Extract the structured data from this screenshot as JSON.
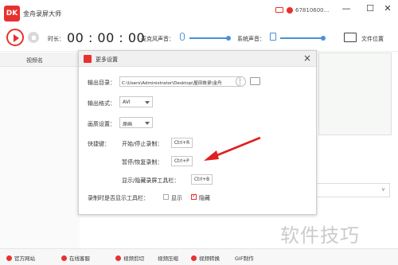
{
  "app": {
    "logo_text": "DK",
    "title": "金舟录屏大师",
    "user_id": "67810600..."
  },
  "window": {
    "minimize": "—",
    "maximize": "☐",
    "close": "✕"
  },
  "toolbar": {
    "duration_label": "时长：",
    "timer": "00 : 00 : 00",
    "mic_label": "麦克风声音：",
    "system_label": "系统声音：",
    "file_location": "文件位置"
  },
  "list": {
    "header": "视频名"
  },
  "background": {
    "dropdown_arrow": "∨"
  },
  "dialog": {
    "title": "更多设置",
    "close": "×",
    "output_dir_label": "输出目录：",
    "output_dir_value": "C:\\Users\\Administrator\\Desktop\\屋田故录\\金舟",
    "more_btn": "···",
    "output_format_label": "输出格式：",
    "output_format_value": "AVI",
    "quality_label": "画质设置：",
    "quality_value": "原画",
    "hotkey_label": "快捷键：",
    "hotkeys": [
      {
        "label": "开始/停止录制：",
        "key": "Ctrl+R"
      },
      {
        "label": "暂停/恢复录制：",
        "key": "Ctrl+P"
      },
      {
        "label": "显示/隐藏录屏工具栏：",
        "key": "Ctrl+B"
      }
    ],
    "toolbar_during_rec_label": "录制时是否显示工具栏：",
    "option_show": "显示",
    "option_hide": "隐藏",
    "selected_option": "隐藏"
  },
  "bottombar": {
    "items": [
      "官方网站",
      "在线客服",
      "视频剪切",
      "视频压缩",
      "视频转换",
      "GIF制作"
    ]
  },
  "watermark": "软件技巧",
  "colors": {
    "accent": "#e8312f",
    "slider": "#4a90d9",
    "annotation_arrow": "#e02020"
  }
}
